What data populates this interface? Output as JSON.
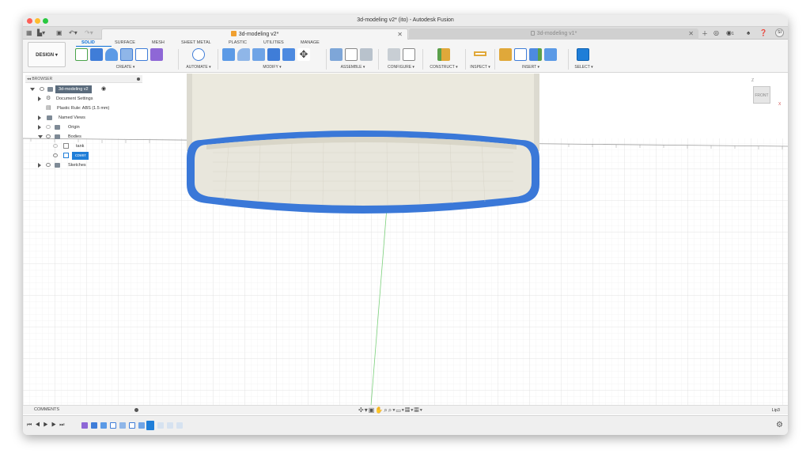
{
  "window": {
    "title": "3d-modeling v2* (ito) - Autodesk Fusion"
  },
  "qat": {
    "grid_icon": "grid-icon",
    "file_icon": "file-icon",
    "save_icon": "save-icon",
    "undo_icon": "undo-icon",
    "redo_icon": "redo-icon",
    "home_icon": "home-icon",
    "user_initials": "SI",
    "notifications": "1"
  },
  "doc_tabs": [
    {
      "label": "3d-modeling v2*",
      "active": true
    },
    {
      "label": "3d-modeling v1*",
      "active": false
    }
  ],
  "workspace": {
    "label": "DESIGN"
  },
  "ribbon_tabs": [
    {
      "label": "SOLID",
      "active": true
    },
    {
      "label": "SURFACE"
    },
    {
      "label": "MESH"
    },
    {
      "label": "SHEET METAL"
    },
    {
      "label": "PLASTIC"
    },
    {
      "label": "UTILITIES"
    },
    {
      "label": "MANAGE"
    }
  ],
  "ribbon_groups": [
    {
      "label": "CREATE ▾"
    },
    {
      "label": "AUTOMATE ▾"
    },
    {
      "label": "MODIFY ▾"
    },
    {
      "label": "ASSEMBLE ▾"
    },
    {
      "label": "CONFIGURE ▾"
    },
    {
      "label": "CONSTRUCT ▾"
    },
    {
      "label": "INSPECT ▾"
    },
    {
      "label": "INSERT ▾"
    },
    {
      "label": "SELECT ▾"
    }
  ],
  "browser": {
    "title": "BROWSER",
    "root": "3d-modeling v2",
    "items": [
      {
        "label": "Document Settings"
      },
      {
        "label": "Plastic Rule: ABS (1.5 mm)"
      },
      {
        "label": "Named Views"
      },
      {
        "label": "Origin"
      },
      {
        "label": "Bodies"
      },
      {
        "label": "tank"
      },
      {
        "label": "cover"
      },
      {
        "label": "Sketches"
      }
    ]
  },
  "viewcube": {
    "face": "FRONT",
    "axis_z": "Z",
    "axis_x": "X"
  },
  "comments": {
    "label": "COMMENTS"
  },
  "status": {
    "right_label": "Lip3"
  },
  "colors": {
    "accent": "#1f7ed8",
    "selected_body": "#3a78d8",
    "model_fill": "#ebe9de"
  }
}
